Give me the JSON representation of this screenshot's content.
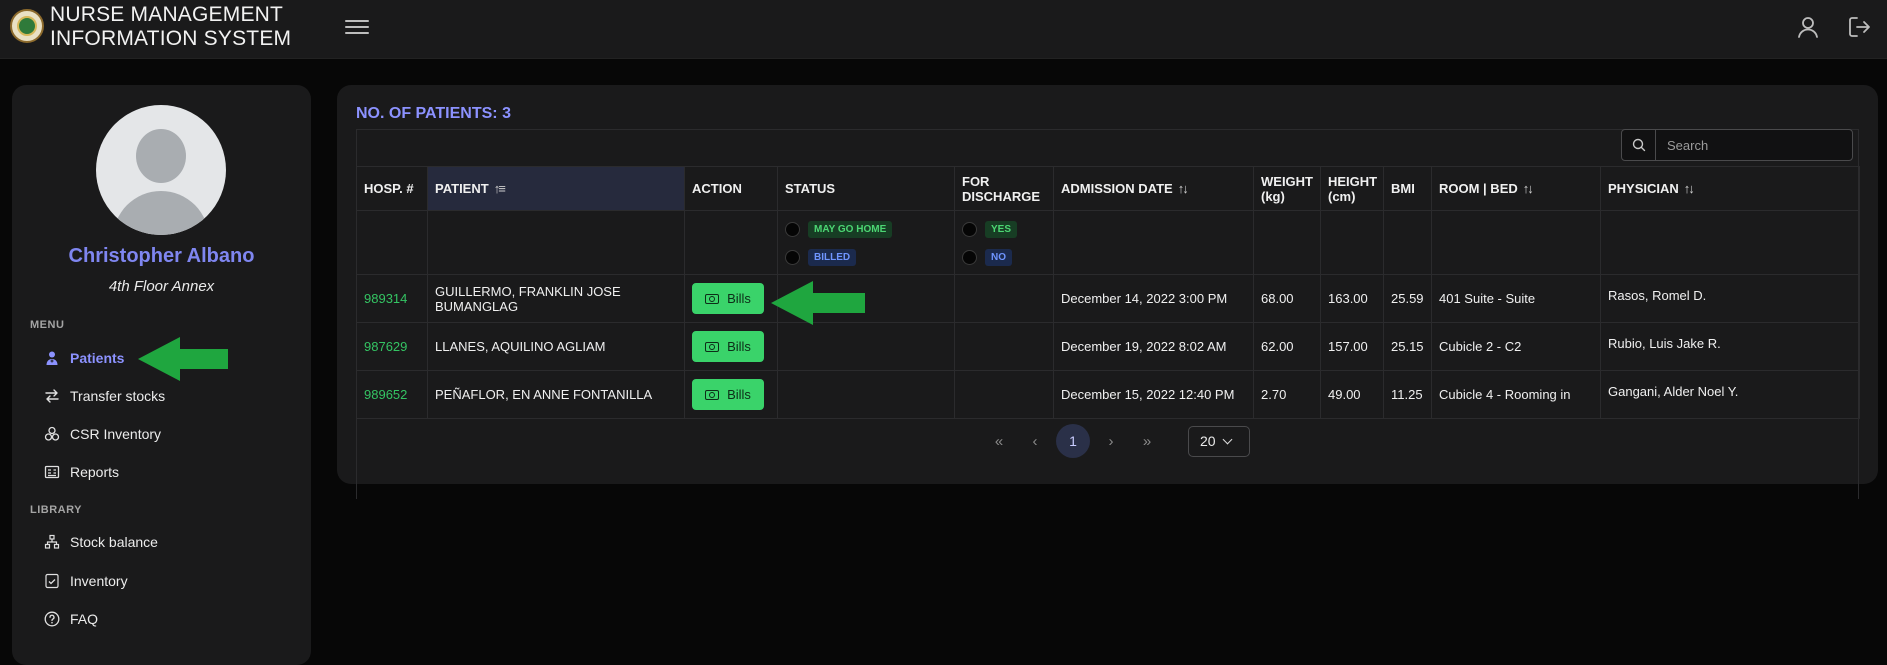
{
  "app": {
    "title_line1": "NURSE MANAGEMENT",
    "title_line2": "INFORMATION SYSTEM",
    "logo_icon": "seal-logo"
  },
  "header": {
    "menu_icon": "hamburger-icon",
    "user_icon": "user-icon",
    "logout_icon": "logout-icon"
  },
  "user": {
    "name": "Christopher Albano",
    "location": "4th Floor Annex"
  },
  "sidebar": {
    "menu_label": "MENU",
    "menu_items": [
      {
        "label": "Patients",
        "icon": "nurse-icon",
        "active": true
      },
      {
        "label": "Transfer stocks",
        "icon": "transfer-icon"
      },
      {
        "label": "CSR Inventory",
        "icon": "boxes-icon"
      },
      {
        "label": "Reports",
        "icon": "report-icon"
      }
    ],
    "library_label": "LIBRARY",
    "library_items": [
      {
        "label": "Stock balance",
        "icon": "hierarchy-icon"
      },
      {
        "label": "Inventory",
        "icon": "checklist-icon"
      },
      {
        "label": "FAQ",
        "icon": "question-icon"
      }
    ]
  },
  "main": {
    "count_label": "NO. OF PATIENTS: 3",
    "search_placeholder": "Search",
    "columns": {
      "hosp": "HOSP. #",
      "patient": "PATIENT",
      "action": "ACTION",
      "status": "STATUS",
      "discharge_line1": "FOR",
      "discharge_line2": "DISCHARGE",
      "admission": "ADMISSION DATE",
      "weight_line1": "WEIGHT",
      "weight_line2": "(kg)",
      "height_line1": "HEIGHT",
      "height_line2": "(cm)",
      "bmi": "BMI",
      "room": "ROOM | BED",
      "physician": "PHYSICIAN"
    },
    "filters": {
      "status_options": [
        "MAY GO HOME",
        "BILLED"
      ],
      "discharge_options": [
        "YES",
        "NO"
      ]
    },
    "rows": [
      {
        "hosp": "989314",
        "patient_line1": "GUILLERMO, FRANKLIN JOSE",
        "patient_line2": "BUMANGLAG",
        "action": "Bills",
        "admission": "December 14, 2022 3:00 PM",
        "weight": "68.00",
        "height": "163.00",
        "bmi": "25.59",
        "room": "401 Suite - Suite",
        "physician": "Rasos, Romel D."
      },
      {
        "hosp": "987629",
        "patient_line1": "LLANES, AQUILINO AGLIAM",
        "patient_line2": "",
        "action": "Bills",
        "admission": "December 19, 2022 8:02 AM",
        "weight": "62.00",
        "height": "157.00",
        "bmi": "25.15",
        "room": "Cubicle 2 - C2",
        "physician": "Rubio, Luis Jake R."
      },
      {
        "hosp": "989652",
        "patient_line1": "PEÑAFLOR, EN ANNE FONTANILLA",
        "patient_line2": "",
        "action": "Bills",
        "admission": "December 15, 2022 12:40 PM",
        "weight": "2.70",
        "height": "49.00",
        "bmi": "11.25",
        "room": "Cubicle 4 - Rooming in",
        "physician": "Gangani, Alder Noel Y."
      }
    ],
    "pagination": {
      "current_page": "1",
      "per_page": "20"
    }
  },
  "colors": {
    "accent": "#8c92ff",
    "success": "#3ad36a",
    "annotation_arrow": "#1fa63f"
  }
}
